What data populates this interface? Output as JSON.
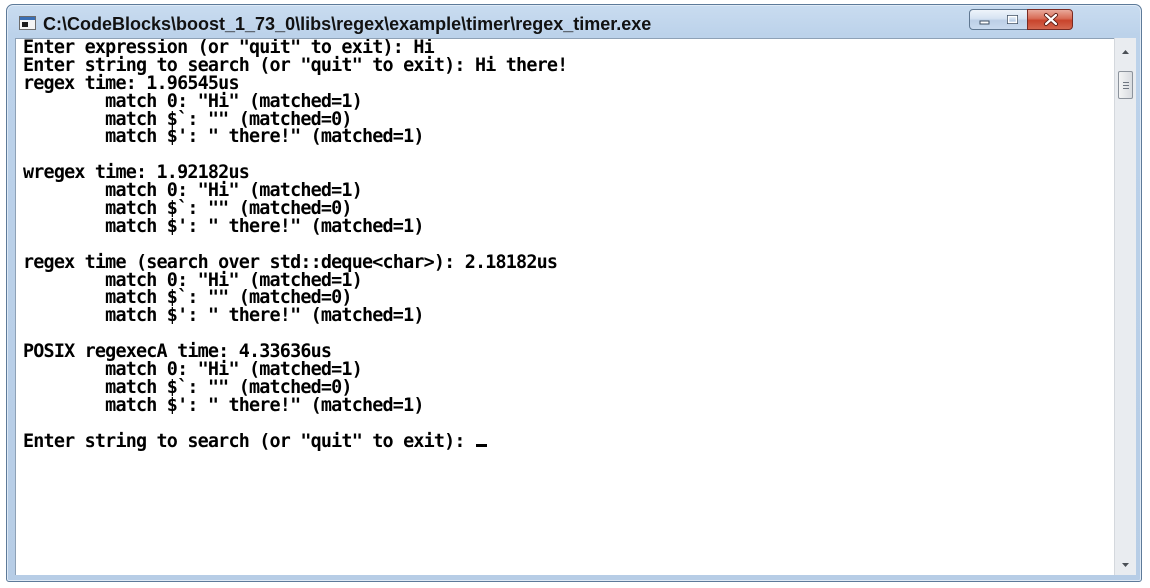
{
  "window": {
    "title": "C:\\CodeBlocks\\boost_1_73_0\\libs\\regex\\example\\timer\\regex_timer.exe",
    "icon": "console-app-icon"
  },
  "controls": {
    "minimize_icon": "minimize-icon",
    "maximize_icon": "maximize-icon",
    "close_icon": "close-icon"
  },
  "console": {
    "lines": [
      "Enter expression (or \"quit\" to exit): Hi",
      "Enter string to search (or \"quit\" to exit): Hi there!",
      "regex time: 1.96545us",
      "        match 0: \"Hi\" (matched=1)",
      "        match $`: \"\" (matched=0)",
      "        match $': \" there!\" (matched=1)",
      "",
      "wregex time: 1.92182us",
      "        match 0: \"Hi\" (matched=1)",
      "        match $`: \"\" (matched=0)",
      "        match $': \" there!\" (matched=1)",
      "",
      "regex time (search over std::deque<char>): 2.18182us",
      "        match 0: \"Hi\" (matched=1)",
      "        match $`: \"\" (matched=0)",
      "        match $': \" there!\" (matched=1)",
      "",
      "POSIX regexecA time: 4.33636us",
      "        match 0: \"Hi\" (matched=1)",
      "        match $`: \"\" (matched=0)",
      "        match $': \" there!\" (matched=1)",
      "",
      "Enter string to search (or \"quit\" to exit): "
    ],
    "cursor": "text-cursor"
  },
  "scrollbar": {
    "up_icon": "scroll-up-arrow-icon",
    "down_icon": "scroll-down-arrow-icon"
  },
  "colors": {
    "frame": "#bcd2ea",
    "close_button": "#c8432b",
    "console_background": "#ffffff",
    "console_text": "#000000"
  }
}
